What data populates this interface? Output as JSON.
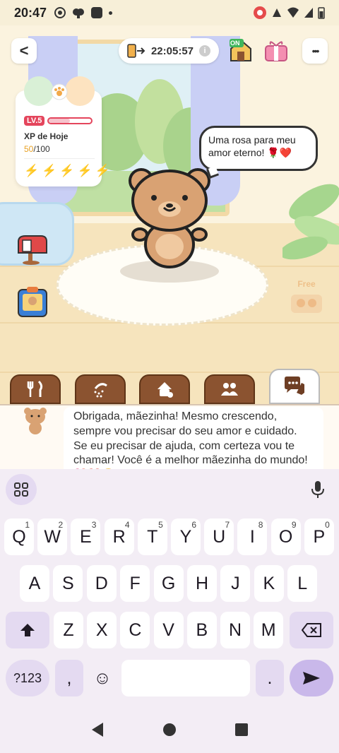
{
  "status_bar": {
    "time": "20:47"
  },
  "header": {
    "back_label": "<",
    "timer": "22:05:57",
    "timer_info": "i",
    "more_label": "•••",
    "on_badge": "ON"
  },
  "profile_card": {
    "level": "LV.5",
    "xp_label": "XP de Hoje",
    "xp_current": "50",
    "xp_max": "/100",
    "xp_progress": 0.5,
    "energy_count": 5
  },
  "speech_bubble": {
    "text": "Uma rosa para meu amor eterno! 🌹❤️"
  },
  "free_badge": {
    "label": "Free"
  },
  "tabs": [
    {
      "name": "food",
      "icon": "fork-knife-icon"
    },
    {
      "name": "bath",
      "icon": "shower-icon"
    },
    {
      "name": "play",
      "icon": "toy-icon"
    },
    {
      "name": "friends",
      "icon": "people-icon"
    },
    {
      "name": "chat",
      "icon": "chat-bubbles-icon",
      "active": true
    }
  ],
  "chat": {
    "message": "Obrigada, mãezinha! Mesmo crescendo, sempre vou precisar do seu amor e cuidado. Se eu precisar de ajuda, com certeza vou te chamar! Você é a melhor mãezinha do mundo! 💖❤️😊"
  },
  "keyboard": {
    "row1": [
      {
        "k": "Q",
        "n": "1"
      },
      {
        "k": "W",
        "n": "2"
      },
      {
        "k": "E",
        "n": "3"
      },
      {
        "k": "R",
        "n": "4"
      },
      {
        "k": "T",
        "n": "5"
      },
      {
        "k": "Y",
        "n": "6"
      },
      {
        "k": "U",
        "n": "7"
      },
      {
        "k": "I",
        "n": "8"
      },
      {
        "k": "O",
        "n": "9"
      },
      {
        "k": "P",
        "n": "0"
      }
    ],
    "row2": [
      "A",
      "S",
      "D",
      "F",
      "G",
      "H",
      "J",
      "K",
      "L"
    ],
    "row3": [
      "Z",
      "X",
      "C",
      "V",
      "B",
      "N",
      "M"
    ],
    "symbols": "?123",
    "comma": ",",
    "period": ".",
    "emoji": "☺"
  }
}
